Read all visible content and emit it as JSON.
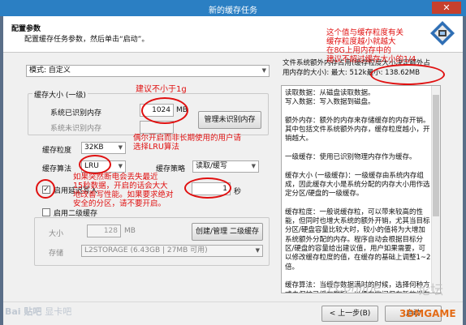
{
  "window": {
    "title": "新的缓存任务",
    "close": "✕"
  },
  "header": {
    "title": "配置参数",
    "subtitle": "配置缓存任务参数，然后单击“启动”。"
  },
  "mode_combo": {
    "value": "模式: 自定义"
  },
  "cache_size": {
    "group_label": "缓存大小 (一级)",
    "recognized_label": "系统已识别内存",
    "recognized_value": "1024",
    "recognized_unit": "MB",
    "unrecognized_label": "系统未识别内存",
    "manage_button": "管理未识别内存"
  },
  "granularity": {
    "label": "缓存粒度",
    "value": "32KB"
  },
  "algorithm": {
    "label": "缓存算法",
    "value": "LRU"
  },
  "strategy": {
    "label": "缓存策略",
    "value": "读取/缓写"
  },
  "delay_write": {
    "checked": true,
    "label": "启用延迟写入",
    "value": "1",
    "unit": "秒"
  },
  "level2": {
    "checkbox_label": "启用二级缓存",
    "size_label": "大小",
    "size_value": "128",
    "size_unit": "MB",
    "manage_button": "创建/管理 二级缓存",
    "storage_label": "存储",
    "storage_value": "L2STORAGE (6.43GB | 27MB 可用)"
  },
  "info": {
    "line1": "文件系统额外内存占用(缓存粒度大小决定额外占",
    "line2": "用内存的大小): ",
    "max": "最大: 512k最小: ",
    "min_value": "138.62MB"
  },
  "help_text": "读取数据：从磁盘读取数据。\n写入数据：写入数据到磁盘。\n\n额外内存：额外的内存来存储缓存的内存开销。其中包括文件系统额外内存，缓存粒度越小，开销越大。\n\n一级缓存：使用已识别物理内存作为缓存。\n\n缓存大小 (一级缓存)：一级缓存由系统内存组成，因此缓存大小是系统分配的内存大小用作选定分区/硬盘的一级缓存。\n\n缓存粒度：一般说缓存粒，可以带来较高的性能，但同时也增大系统的额外开销，尤其当目标分区/硬盘容量比较大时，较小的值将为大增加系统额外分配的内存。程序自动会根据目标分区/硬盘的容量给出建议值，用户如果需要，可以修改缓存粒度的值，在缓存的基础上调整1~2倍。\n\n缓存算法：当缓存数据满时的时候，选择何种方式去保护已缓存数据，以便有空间保存新的缓存数据。\n\n• LRU (Least Recently Used)：最近最少使用",
  "annotations": {
    "top": "这个值与缓存粒度有关\n缓存粒度越小就越大\n在8G上用内存中的\n建议不超过缓存大小的1/4",
    "size": "建议不小于1g",
    "algo": "偶尔开启而非长期使用的用户请\n选择LRU算法",
    "delay": "如果突然断电会丢失最近\n15秒数据，开启的话会大大\n地改善写性能。如果要求绝对\n安全的分区，请不要开启。"
  },
  "footer": {
    "prev_button": "< 上一步(B)",
    "next_button": "启动"
  },
  "watermarks": {
    "baidu": "Bai 贴吧",
    "bar": "显卡吧",
    "pconline": "PConline",
    "forum": "论坛",
    "site": "3DMGAME"
  },
  "colors": {
    "titlebar": "#2b7fc3",
    "annotation": "#e01010",
    "background": "#f0f0f0"
  }
}
